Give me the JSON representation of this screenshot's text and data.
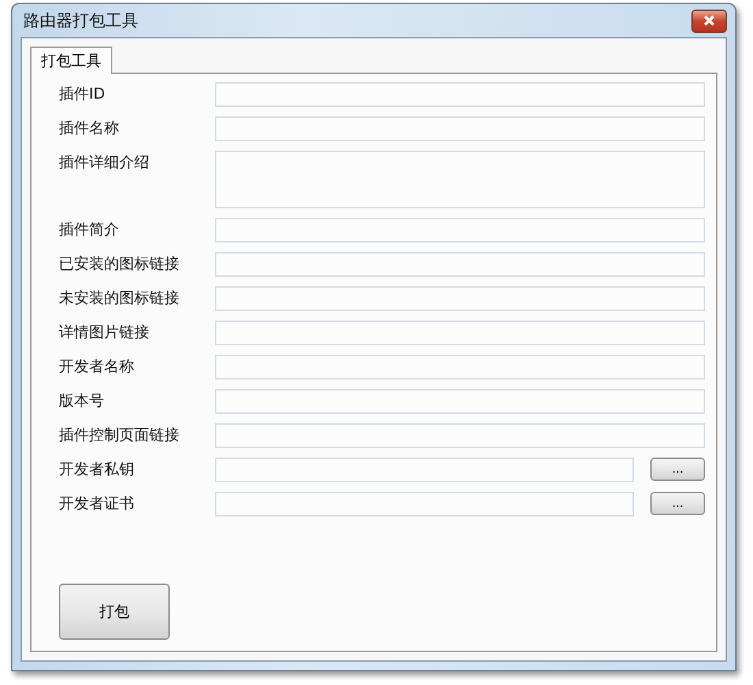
{
  "window": {
    "title": "路由器打包工具"
  },
  "tabs": [
    {
      "label": "打包工具",
      "selected": true
    }
  ],
  "fields": [
    {
      "kind": "text",
      "label": "插件ID"
    },
    {
      "kind": "text",
      "label": "插件名称"
    },
    {
      "kind": "multiline",
      "label": "插件详细介绍"
    },
    {
      "kind": "text",
      "label": "插件简介"
    },
    {
      "kind": "text",
      "label": "已安装的图标链接"
    },
    {
      "kind": "text",
      "label": "未安装的图标链接"
    },
    {
      "kind": "text",
      "label": "详情图片链接"
    },
    {
      "kind": "text",
      "label": "开发者名称"
    },
    {
      "kind": "text",
      "label": "版本号"
    },
    {
      "kind": "text",
      "label": "插件控制页面链接"
    },
    {
      "kind": "file",
      "label": "开发者私钥",
      "button": "..."
    },
    {
      "kind": "file",
      "label": "开发者证书",
      "button": "..."
    }
  ],
  "pack_button": "打包"
}
